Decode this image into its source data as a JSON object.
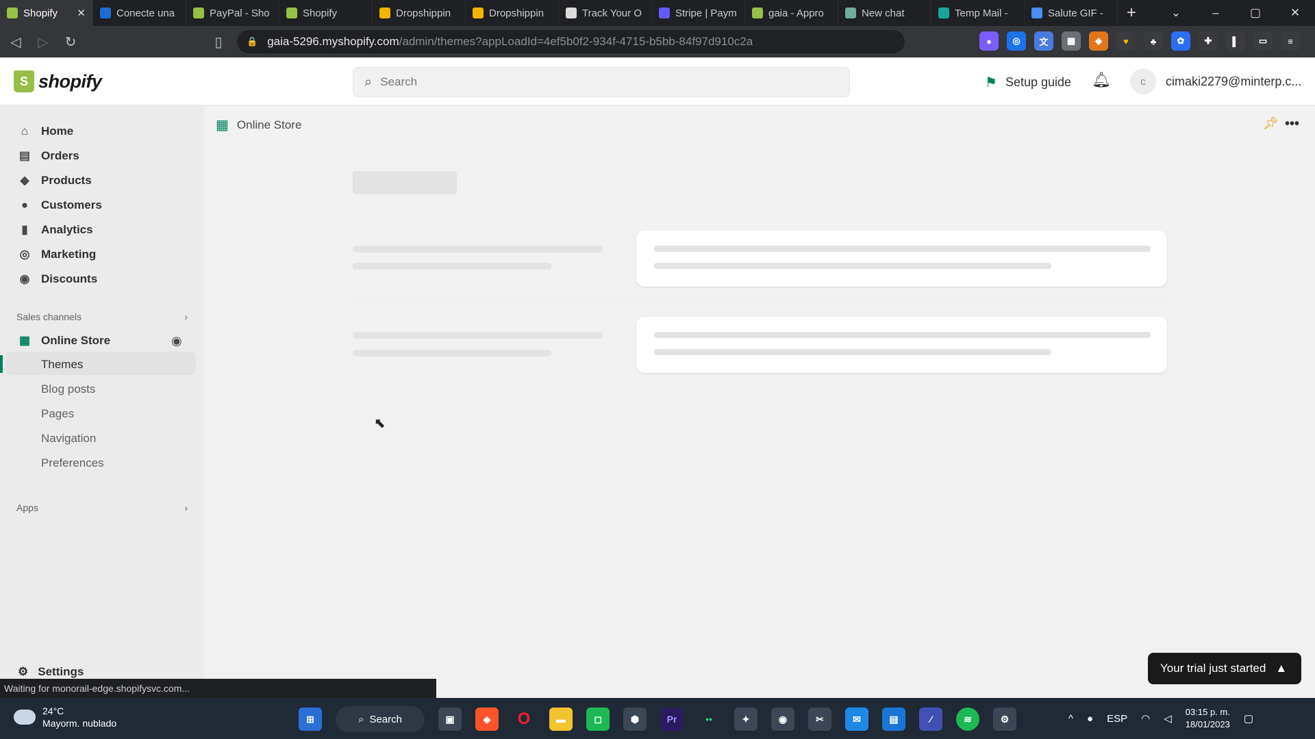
{
  "browser": {
    "tabs": [
      {
        "label": "Shopify",
        "color": "#95bf47",
        "active": true
      },
      {
        "label": "Conecte una",
        "color": "#1e6bd6"
      },
      {
        "label": "PayPal - Sho",
        "color": "#95bf47"
      },
      {
        "label": "Shopify",
        "color": "#95bf47"
      },
      {
        "label": "Dropshippin",
        "color": "#f4b400"
      },
      {
        "label": "Dropshippin",
        "color": "#f4b400"
      },
      {
        "label": "Track Your O",
        "color": "#dddddd"
      },
      {
        "label": "Stripe | Paym",
        "color": "#635bff"
      },
      {
        "label": "gaia - Appro",
        "color": "#95bf47"
      },
      {
        "label": "New chat",
        "color": "#74aa9c"
      },
      {
        "label": "Temp Mail -",
        "color": "#1aa59a"
      },
      {
        "label": "Salute GIF -",
        "color": "#4a8ef0"
      }
    ],
    "url_main": "gaia-5296.myshopify.com",
    "url_rest": "/admin/themes?appLoadId=4ef5b0f2-934f-4715-b5bb-84f97d910c2a"
  },
  "topbar": {
    "logo_text": "shopify",
    "search_placeholder": "Search",
    "setup_guide": "Setup guide",
    "account_initial": "c",
    "account_email": "cimaki2279@minterp.c..."
  },
  "sidebar": {
    "items": [
      {
        "label": "Home",
        "icon": "home-icon",
        "glyph": "⌂"
      },
      {
        "label": "Orders",
        "icon": "orders-icon",
        "glyph": "▤"
      },
      {
        "label": "Products",
        "icon": "tag-icon",
        "glyph": "◆"
      },
      {
        "label": "Customers",
        "icon": "person-icon",
        "glyph": "●"
      },
      {
        "label": "Analytics",
        "icon": "bar-chart-icon",
        "glyph": "▮"
      },
      {
        "label": "Marketing",
        "icon": "target-icon",
        "glyph": "◎"
      },
      {
        "label": "Discounts",
        "icon": "discount-icon",
        "glyph": "◉"
      }
    ],
    "sales_channels": "Sales channels",
    "online_store": "Online Store",
    "sub_items": [
      "Themes",
      "Blog posts",
      "Pages",
      "Navigation",
      "Preferences"
    ],
    "apps": "Apps",
    "settings": "Settings"
  },
  "main": {
    "breadcrumb": "Online Store"
  },
  "status_text": "Waiting for monorail-edge.shopifysvc.com...",
  "toast": "Your trial just started",
  "taskbar": {
    "temperature": "24°C",
    "weather": "Mayorm. nublado",
    "search": "Search",
    "lang": "ESP",
    "time": "03:15 p. m.",
    "date": "18/01/2023"
  }
}
